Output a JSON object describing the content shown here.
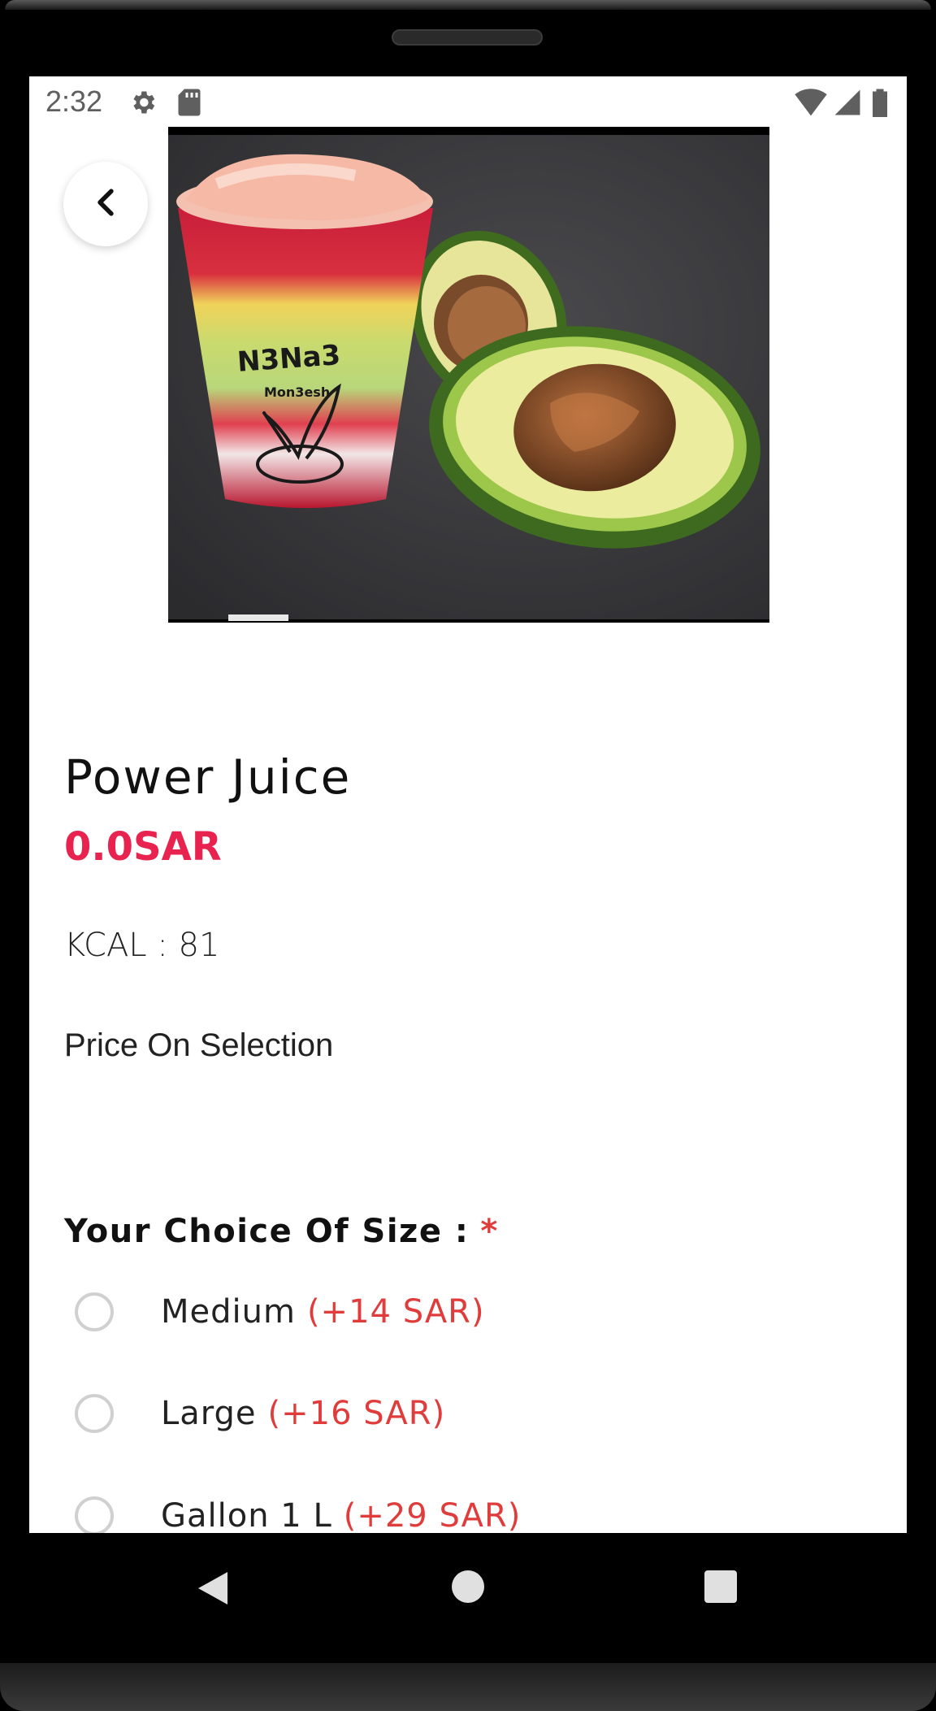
{
  "status_bar": {
    "time": "2:32",
    "icons_left": [
      "gear-icon",
      "sd-card-icon"
    ],
    "icons_right": [
      "wifi-icon",
      "cellular-signal-icon",
      "battery-icon"
    ]
  },
  "product": {
    "title": "Power Juice",
    "price": "0.0SAR",
    "kcal": "KCAL : 81",
    "price_note": "Price On Selection",
    "image_branding": "N3Na3 Mon3esh"
  },
  "size_section": {
    "title": "Your Choice Of Size :",
    "required_mark": "*",
    "options": [
      {
        "label": "Medium",
        "price": "(+14 SAR)",
        "selected": false
      },
      {
        "label": "Large",
        "price": "(+16 SAR)",
        "selected": false
      },
      {
        "label": "Gallon 1 L",
        "price": "(+29 SAR)",
        "selected": false
      }
    ]
  },
  "colors": {
    "accent_price": "#e8234f",
    "option_price": "#e03c3c",
    "required": "#e03c3c"
  },
  "navigation": {
    "buttons": [
      "back-icon",
      "home-icon",
      "recents-icon"
    ]
  }
}
